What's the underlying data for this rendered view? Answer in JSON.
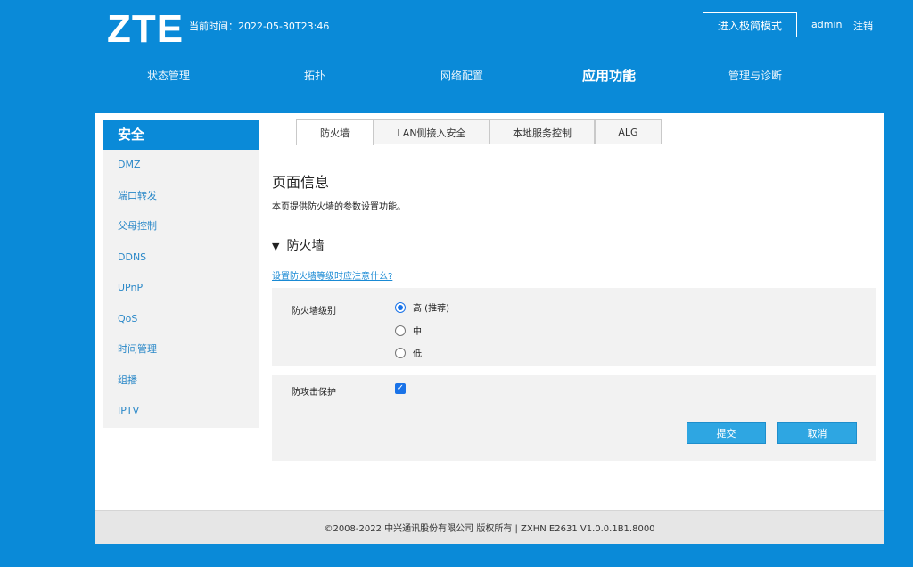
{
  "header": {
    "logo": "ZTE",
    "time_label": "当前时间：",
    "time_value": "2022-05-30T23:46",
    "simple_mode_button": "进入极简模式",
    "user": "admin",
    "logout": "注销"
  },
  "nav": {
    "items": [
      "状态管理",
      "拓扑",
      "网络配置",
      "应用功能",
      "管理与诊断"
    ],
    "active": "应用功能"
  },
  "sidebar": {
    "title": "安全",
    "items": [
      "DMZ",
      "端口转发",
      "父母控制",
      "DDNS",
      "UPnP",
      "QoS",
      "时间管理",
      "组播",
      "IPTV"
    ]
  },
  "tabs": {
    "items": [
      "防火墙",
      "LAN侧接入安全",
      "本地服务控制",
      "ALG"
    ],
    "active": "防火墙"
  },
  "content": {
    "page_title": "页面信息",
    "page_desc": "本页提供防火墙的参数设置功能。",
    "section_arrow": "▼",
    "section_title": "防火墙",
    "help_link": "设置防火墙等级时应注意什么?",
    "firewall_level_label": "防火墙级别",
    "levels": [
      "高 (推荐)",
      "中",
      "低"
    ],
    "selected_level": "高 (推荐)",
    "attack_protection_label": "防攻击保护",
    "attack_protection_checked": true,
    "submit": "提交",
    "cancel": "取消"
  },
  "footer": {
    "text": "©2008-2022 中兴通讯股份有限公司 版权所有  |  ZXHN E2631 V1.0.0.1B1.8000"
  },
  "colors": {
    "brand_blue": "#0a8ad8",
    "button_blue": "#2ea6e2",
    "link_blue": "#1a8ad4"
  }
}
